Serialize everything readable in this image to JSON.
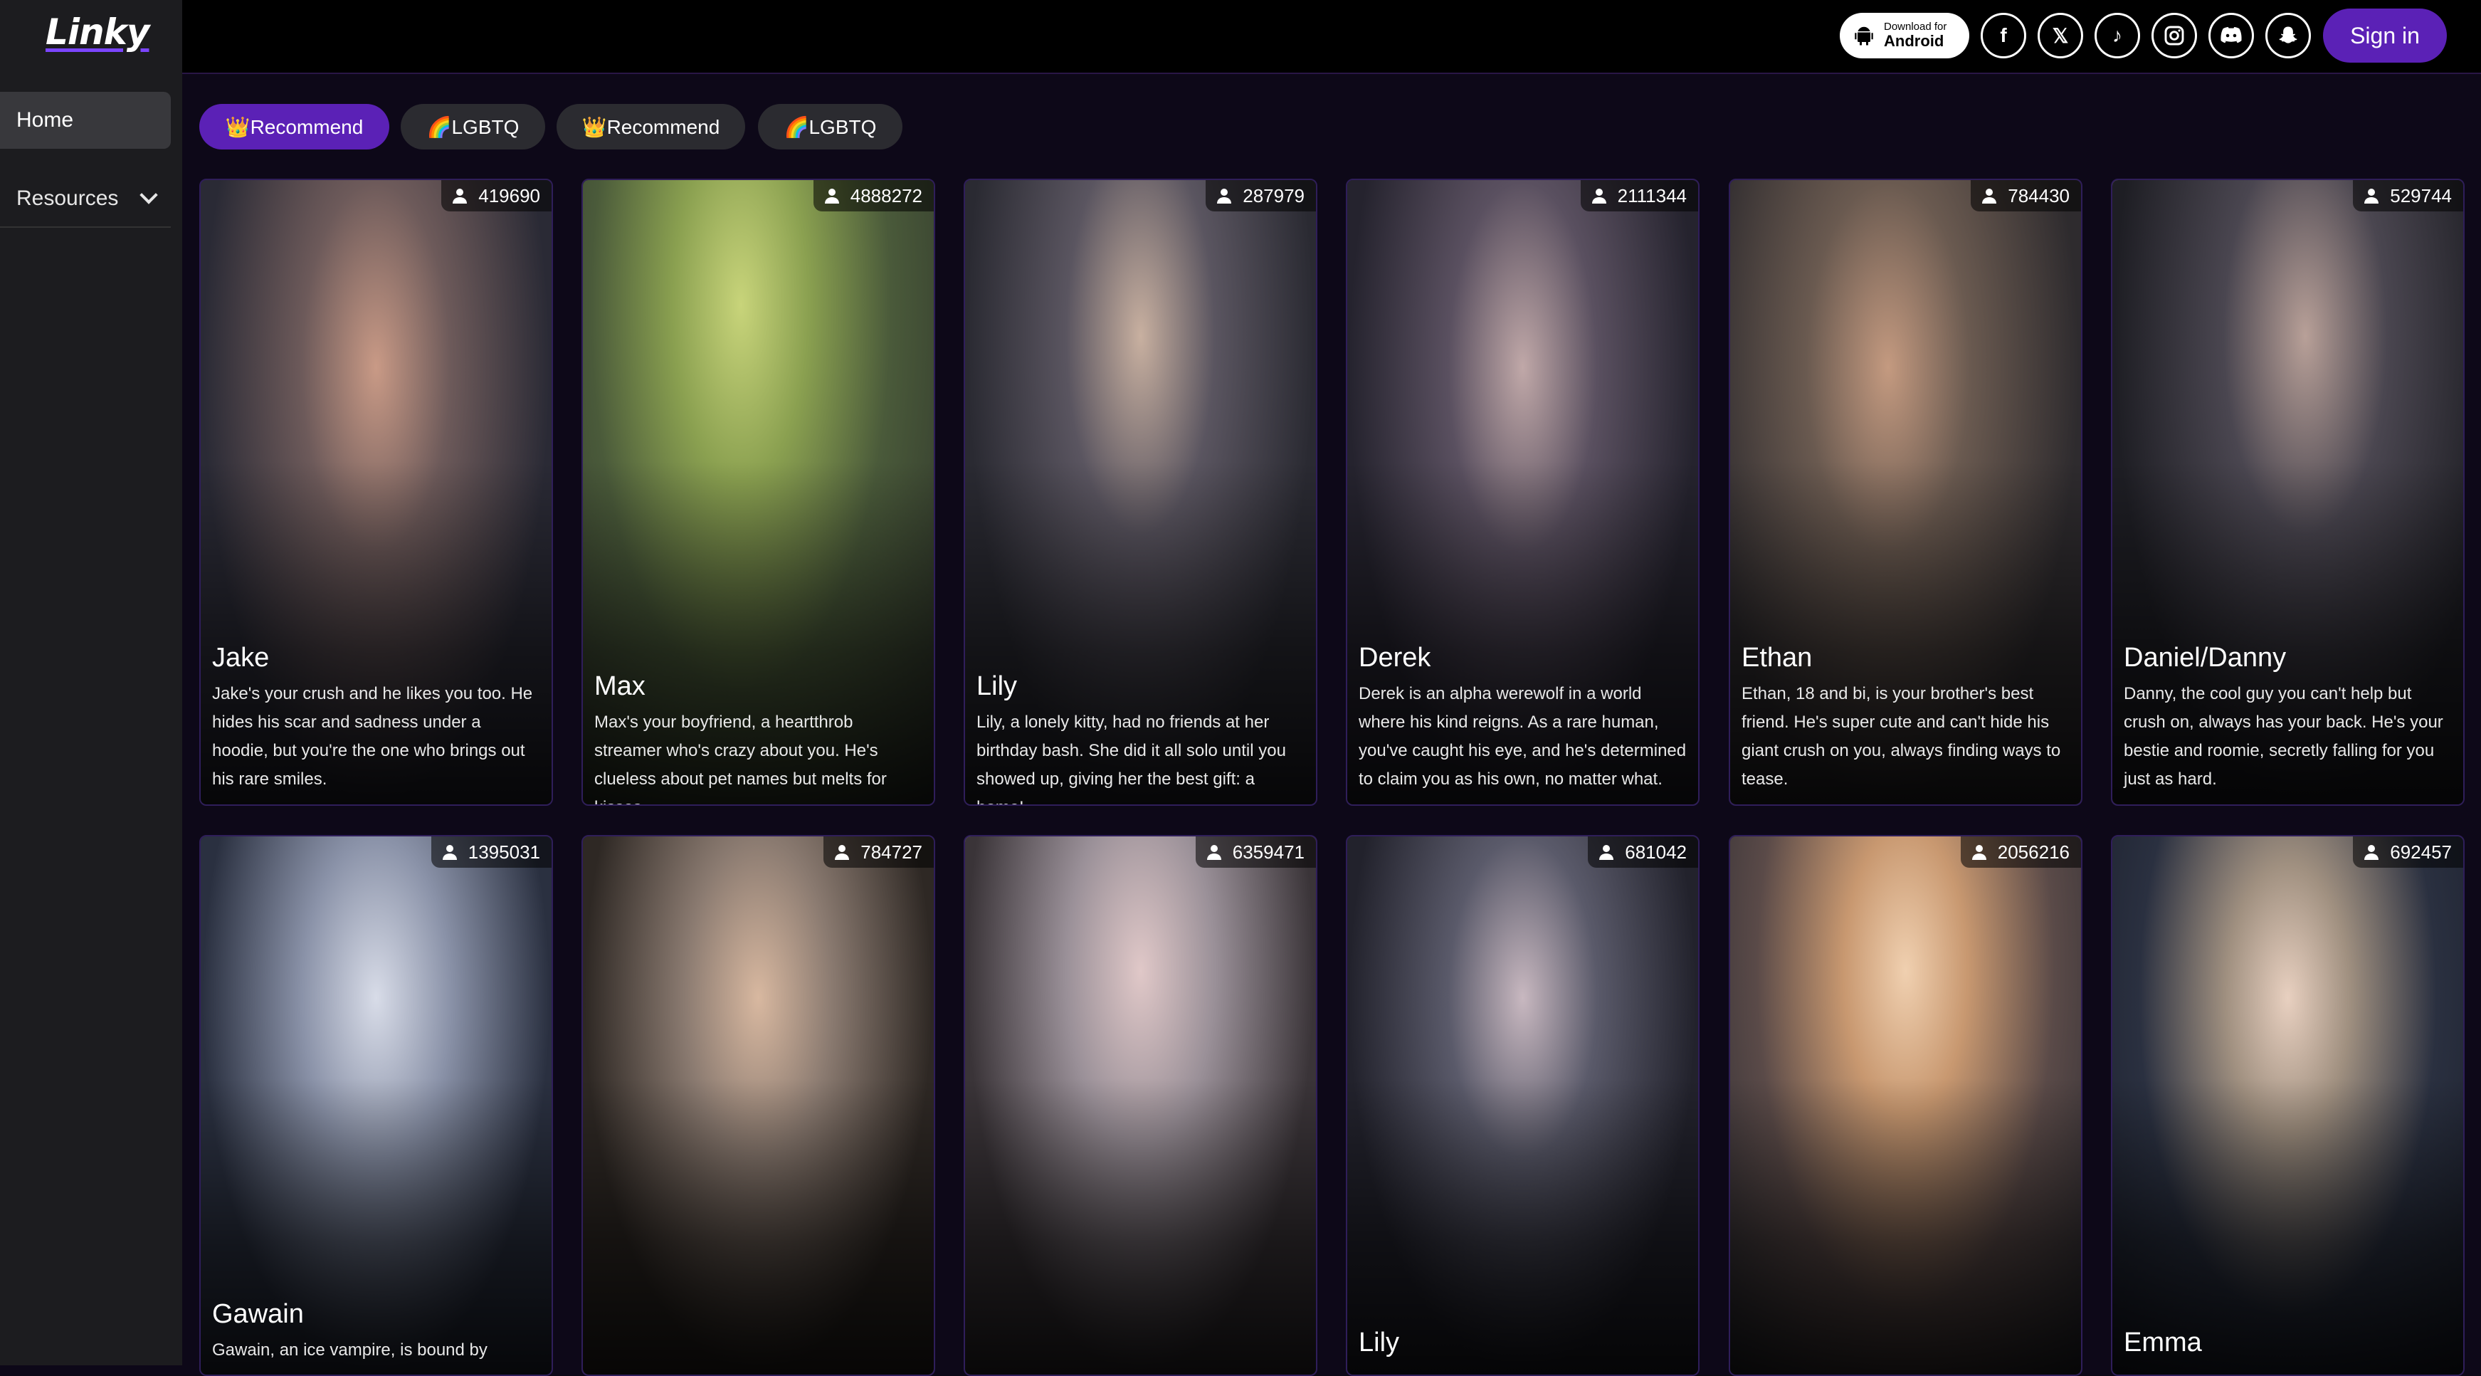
{
  "app": {
    "logo": "Linky"
  },
  "sidebar": {
    "items": [
      {
        "label": "Home"
      },
      {
        "label": "Resources"
      }
    ]
  },
  "header": {
    "android": {
      "small": "Download for",
      "big": "Android"
    },
    "social_icons": [
      "facebook-icon",
      "x-icon",
      "tiktok-icon",
      "instagram-icon",
      "discord-icon",
      "snapchat-icon"
    ],
    "signin_label": "Sign in"
  },
  "tabs": [
    {
      "label": "👑Recommend",
      "active": true
    },
    {
      "label": "🌈LGBTQ",
      "active": false
    },
    {
      "label": "👑Recommend",
      "active": false
    },
    {
      "label": "🌈LGBTQ",
      "active": false
    }
  ],
  "cards": [
    {
      "name": "Jake",
      "count": "419690",
      "desc": "Jake's your crush and he likes you too. He hides his scar and sadness under a hoodie, but you're the one who brings out his rare smiles."
    },
    {
      "name": "Max",
      "count": "4888272",
      "desc": "Max's your boyfriend, a heartthrob streamer who's crazy about you. He's clueless about pet names but melts for kisses."
    },
    {
      "name": "Lily",
      "count": "287979",
      "desc": "Lily, a lonely kitty, had no friends at her birthday bash. She did it all solo until you showed up, giving her the best gift: a home!"
    },
    {
      "name": "Derek",
      "count": "2111344",
      "desc": "Derek is an alpha werewolf in a world where his kind reigns. As a rare human, you've caught his eye, and he's determined to claim you as his own, no matter what."
    },
    {
      "name": "Ethan",
      "count": "784430",
      "desc": "Ethan, 18 and bi, is your brother's best friend. He's super cute and can't hide his giant crush on you, always finding ways to tease."
    },
    {
      "name": "Daniel/Danny",
      "count": "529744",
      "desc": "Danny, the cool guy you can't help but crush on, always has your back. He's your bestie and roomie, secretly falling for you just as hard."
    },
    {
      "name": "Gawain",
      "count": "1395031",
      "desc": "Gawain, an ice vampire, is bound by"
    },
    {
      "name": "",
      "count": "784727",
      "desc": ""
    },
    {
      "name": "",
      "count": "6359471",
      "desc": ""
    },
    {
      "name": "Lily",
      "count": "681042",
      "desc": ""
    },
    {
      "name": "",
      "count": "2056216",
      "desc": ""
    },
    {
      "name": "Emma",
      "count": "692457",
      "desc": ""
    }
  ],
  "colors": {
    "accent": "#5b21b6",
    "background": "#0d0818",
    "sidebar": "#1c1c1f"
  }
}
